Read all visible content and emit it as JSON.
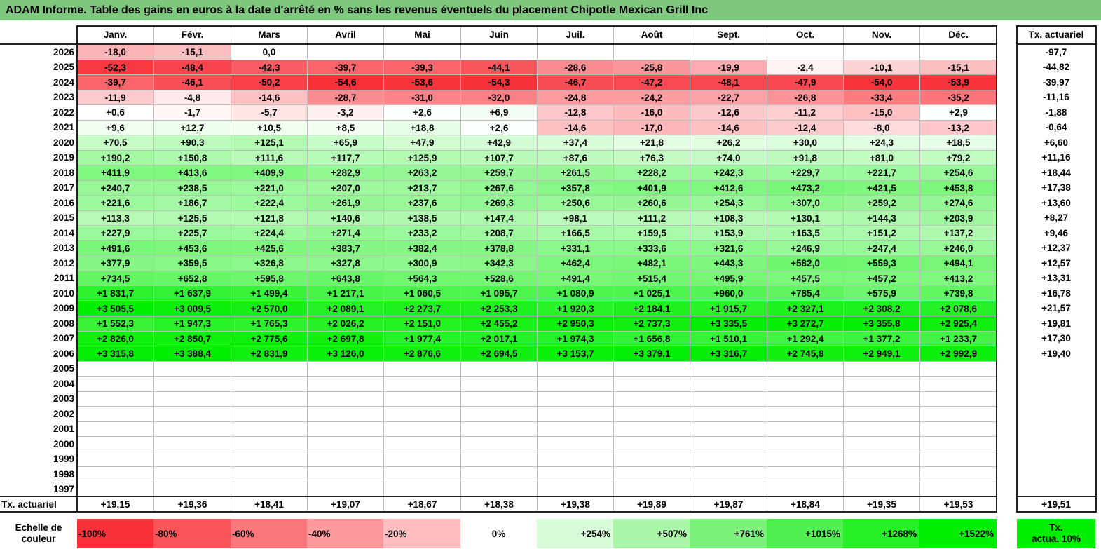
{
  "title": "ADAM Informe. Table des gains en euros à la date d'arrêté en % sans les revenus éventuels du placement Chipotle Mexican Grill Inc",
  "months": [
    "Janv.",
    "Févr.",
    "Mars",
    "Avril",
    "Mai",
    "Juin",
    "Juil.",
    "Août",
    "Sept.",
    "Oct.",
    "Nov.",
    "Déc."
  ],
  "rate_header": "Tx. actuariel",
  "rows": [
    {
      "year": "2026",
      "values": [
        "-18,0",
        "-15,1",
        "0,0",
        "",
        "",
        "",
        "",
        "",
        "",
        "",
        "",
        ""
      ],
      "rate": "-97,7"
    },
    {
      "year": "2025",
      "values": [
        "-52,3",
        "-48,4",
        "-42,3",
        "-39,7",
        "-39,3",
        "-44,1",
        "-28,6",
        "-25,8",
        "-19,9",
        "-2,4",
        "-10,1",
        "-15,1"
      ],
      "rate": "-44,82"
    },
    {
      "year": "2024",
      "values": [
        "-39,7",
        "-46,1",
        "-50,2",
        "-54,6",
        "-53,6",
        "-54,3",
        "-46,7",
        "-47,2",
        "-48,1",
        "-47,9",
        "-54,0",
        "-53,9"
      ],
      "rate": "-39,97"
    },
    {
      "year": "2023",
      "values": [
        "-11,9",
        "-4,8",
        "-14,6",
        "-28,7",
        "-31,0",
        "-32,0",
        "-24,8",
        "-24,2",
        "-22,7",
        "-26,8",
        "-33,4",
        "-35,2"
      ],
      "rate": "-11,16"
    },
    {
      "year": "2022",
      "values": [
        "+0,6",
        "-1,7",
        "-5,7",
        "-3,2",
        "+2,6",
        "+6,9",
        "-12,8",
        "-16,0",
        "-12,6",
        "-11,2",
        "-15,0",
        "+2,9"
      ],
      "rate": "-1,88"
    },
    {
      "year": "2021",
      "values": [
        "+9,6",
        "+12,7",
        "+10,5",
        "+8,5",
        "+18,8",
        "+2,6",
        "-14,6",
        "-17,0",
        "-14,6",
        "-12,4",
        "-8,0",
        "-13,2"
      ],
      "rate": "-0,64"
    },
    {
      "year": "2020",
      "values": [
        "+70,5",
        "+90,3",
        "+125,1",
        "+65,9",
        "+47,9",
        "+42,9",
        "+37,4",
        "+21,8",
        "+26,2",
        "+30,0",
        "+24,3",
        "+18,5"
      ],
      "rate": "+6,60"
    },
    {
      "year": "2019",
      "values": [
        "+190,2",
        "+150,8",
        "+111,6",
        "+117,7",
        "+125,9",
        "+107,7",
        "+87,6",
        "+76,3",
        "+74,0",
        "+91,8",
        "+81,0",
        "+79,2"
      ],
      "rate": "+11,16"
    },
    {
      "year": "2018",
      "values": [
        "+411,9",
        "+413,6",
        "+409,9",
        "+282,9",
        "+263,2",
        "+259,7",
        "+261,5",
        "+228,2",
        "+242,3",
        "+229,7",
        "+221,7",
        "+254,6"
      ],
      "rate": "+18,44"
    },
    {
      "year": "2017",
      "values": [
        "+240,7",
        "+238,5",
        "+221,0",
        "+207,0",
        "+213,7",
        "+267,6",
        "+357,8",
        "+401,9",
        "+412,6",
        "+473,2",
        "+421,5",
        "+453,8"
      ],
      "rate": "+17,38"
    },
    {
      "year": "2016",
      "values": [
        "+221,6",
        "+186,7",
        "+222,4",
        "+261,9",
        "+237,6",
        "+269,3",
        "+250,6",
        "+260,6",
        "+254,3",
        "+307,0",
        "+259,2",
        "+274,6"
      ],
      "rate": "+13,60"
    },
    {
      "year": "2015",
      "values": [
        "+113,3",
        "+125,5",
        "+121,8",
        "+140,6",
        "+138,5",
        "+147,4",
        "+98,1",
        "+111,2",
        "+108,3",
        "+130,1",
        "+144,3",
        "+203,9"
      ],
      "rate": "+8,27"
    },
    {
      "year": "2014",
      "values": [
        "+227,9",
        "+225,7",
        "+224,4",
        "+271,4",
        "+233,2",
        "+208,7",
        "+166,5",
        "+159,5",
        "+153,9",
        "+163,5",
        "+151,2",
        "+137,2"
      ],
      "rate": "+9,46"
    },
    {
      "year": "2013",
      "values": [
        "+491,6",
        "+453,6",
        "+425,6",
        "+383,7",
        "+382,4",
        "+378,8",
        "+331,1",
        "+333,6",
        "+321,6",
        "+246,9",
        "+247,4",
        "+246,0"
      ],
      "rate": "+12,37"
    },
    {
      "year": "2012",
      "values": [
        "+377,9",
        "+359,5",
        "+326,8",
        "+327,8",
        "+300,9",
        "+342,3",
        "+462,4",
        "+482,1",
        "+443,3",
        "+582,0",
        "+559,3",
        "+494,1"
      ],
      "rate": "+12,57"
    },
    {
      "year": "2011",
      "values": [
        "+734,5",
        "+652,8",
        "+595,8",
        "+643,8",
        "+564,3",
        "+528,6",
        "+491,4",
        "+515,4",
        "+495,9",
        "+457,5",
        "+457,2",
        "+413,2"
      ],
      "rate": "+13,31"
    },
    {
      "year": "2010",
      "values": [
        "+1 831,7",
        "+1 637,9",
        "+1 499,4",
        "+1 217,1",
        "+1 060,5",
        "+1 095,7",
        "+1 080,9",
        "+1 025,1",
        "+960,0",
        "+785,4",
        "+575,9",
        "+739,8"
      ],
      "rate": "+16,78"
    },
    {
      "year": "2009",
      "values": [
        "+3 505,5",
        "+3 009,5",
        "+2 570,0",
        "+2 089,1",
        "+2 273,7",
        "+2 253,3",
        "+1 920,3",
        "+2 184,1",
        "+1 915,7",
        "+2 327,1",
        "+2 308,2",
        "+2 078,6"
      ],
      "rate": "+21,57"
    },
    {
      "year": "2008",
      "values": [
        "+1 552,3",
        "+1 947,3",
        "+1 765,3",
        "+2 026,2",
        "+2 151,0",
        "+2 455,2",
        "+2 950,3",
        "+2 737,3",
        "+3 335,5",
        "+3 272,7",
        "+3 355,8",
        "+2 925,4"
      ],
      "rate": "+19,81"
    },
    {
      "year": "2007",
      "values": [
        "+2 826,0",
        "+2 850,7",
        "+2 775,6",
        "+2 697,8",
        "+1 977,4",
        "+2 017,1",
        "+1 974,3",
        "+1 656,8",
        "+1 510,1",
        "+1 292,4",
        "+1 377,2",
        "+1 233,7"
      ],
      "rate": "+17,30"
    },
    {
      "year": "2006",
      "values": [
        "+3 315,8",
        "+3 388,4",
        "+2 831,9",
        "+3 126,0",
        "+2 876,6",
        "+2 694,5",
        "+3 153,7",
        "+3 379,1",
        "+3 316,7",
        "+2 745,8",
        "+2 949,1",
        "+2 992,9"
      ],
      "rate": "+19,40"
    },
    {
      "year": "2005",
      "values": [
        "",
        "",
        "",
        "",
        "",
        "",
        "",
        "",
        "",
        "",
        "",
        ""
      ],
      "rate": ""
    },
    {
      "year": "2004",
      "values": [
        "",
        "",
        "",
        "",
        "",
        "",
        "",
        "",
        "",
        "",
        "",
        ""
      ],
      "rate": ""
    },
    {
      "year": "2003",
      "values": [
        "",
        "",
        "",
        "",
        "",
        "",
        "",
        "",
        "",
        "",
        "",
        ""
      ],
      "rate": ""
    },
    {
      "year": "2002",
      "values": [
        "",
        "",
        "",
        "",
        "",
        "",
        "",
        "",
        "",
        "",
        "",
        ""
      ],
      "rate": ""
    },
    {
      "year": "2001",
      "values": [
        "",
        "",
        "",
        "",
        "",
        "",
        "",
        "",
        "",
        "",
        "",
        ""
      ],
      "rate": ""
    },
    {
      "year": "2000",
      "values": [
        "",
        "",
        "",
        "",
        "",
        "",
        "",
        "",
        "",
        "",
        "",
        ""
      ],
      "rate": ""
    },
    {
      "year": "1999",
      "values": [
        "",
        "",
        "",
        "",
        "",
        "",
        "",
        "",
        "",
        "",
        "",
        ""
      ],
      "rate": ""
    },
    {
      "year": "1998",
      "values": [
        "",
        "",
        "",
        "",
        "",
        "",
        "",
        "",
        "",
        "",
        "",
        ""
      ],
      "rate": ""
    },
    {
      "year": "1997",
      "values": [
        "",
        "",
        "",
        "",
        "",
        "",
        "",
        "",
        "",
        "",
        "",
        ""
      ],
      "rate": ""
    }
  ],
  "footer": {
    "label": "Tx. actuariel",
    "values": [
      "+19,15",
      "+19,36",
      "+18,41",
      "+19,07",
      "+18,67",
      "+18,38",
      "+19,38",
      "+19,89",
      "+19,87",
      "+18,84",
      "+19,35",
      "+19,53"
    ],
    "rate": "+19,51"
  },
  "legend": {
    "label_line1": "Echelle de",
    "label_line2": "couleur",
    "steps": [
      "-100%",
      "-80%",
      "-60%",
      "-40%",
      "-20%",
      "0%",
      "+254%",
      "+507%",
      "+761%",
      "+1015%",
      "+1268%",
      "+1522%"
    ],
    "rate_line1": "Tx.",
    "rate_line2": "actua. 10%"
  },
  "colors": {
    "title_bar": "#7ec87e",
    "negative_full": "#f8313a",
    "positive_full": "#00ef00",
    "rate_legend": "#00ef00"
  }
}
